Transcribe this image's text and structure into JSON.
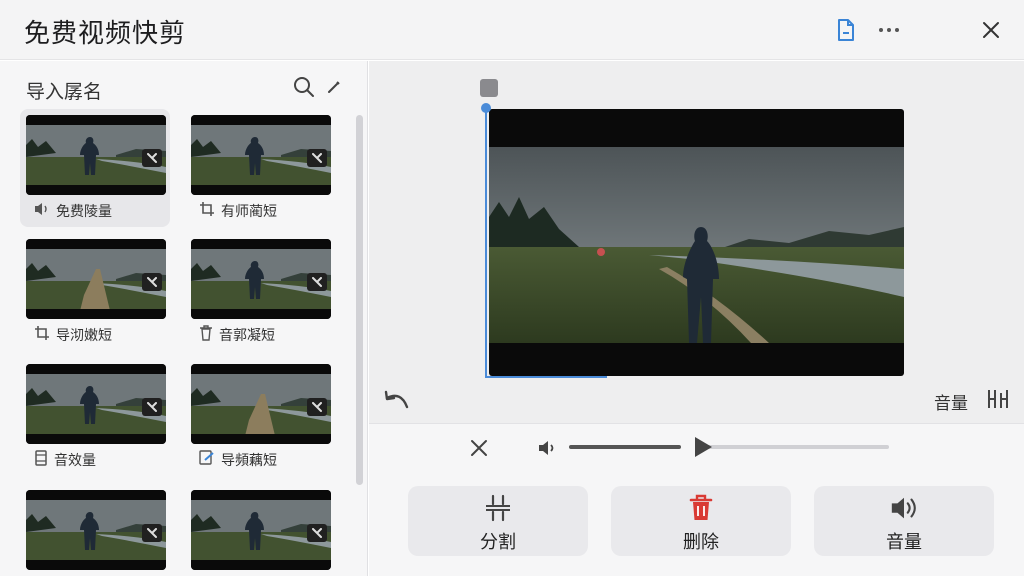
{
  "app": {
    "title": "免费视频快剪"
  },
  "sidebar": {
    "title": "导入孱名",
    "clips": [
      {
        "label": "免费陵量",
        "icon": "speaker-icon",
        "selected": true
      },
      {
        "label": "有师蔺短",
        "icon": "crop-icon",
        "selected": false
      },
      {
        "label": "导沏嫩短",
        "icon": "crop-icon",
        "selected": false
      },
      {
        "label": "音郭凝短",
        "icon": "trash-icon",
        "selected": false
      },
      {
        "label": "音效量",
        "icon": "clip-icon",
        "selected": false
      },
      {
        "label": "导頻藕短",
        "icon": "edit-icon",
        "selected": false
      },
      {
        "label": "",
        "icon": "",
        "selected": false
      },
      {
        "label": "",
        "icon": "",
        "selected": false
      }
    ]
  },
  "preview": {
    "volume_label": "音量"
  },
  "controls": {
    "volume_level": 0.38,
    "buttons": [
      {
        "label": "分割",
        "icon": "split-icon"
      },
      {
        "label": "删除",
        "icon": "trash-icon"
      },
      {
        "label": "音量",
        "icon": "speaker-icon"
      }
    ]
  },
  "colors": {
    "delete_accent": "#d93a34",
    "playhead": "#4a8bd8",
    "doc_icon": "#3a84d6"
  }
}
